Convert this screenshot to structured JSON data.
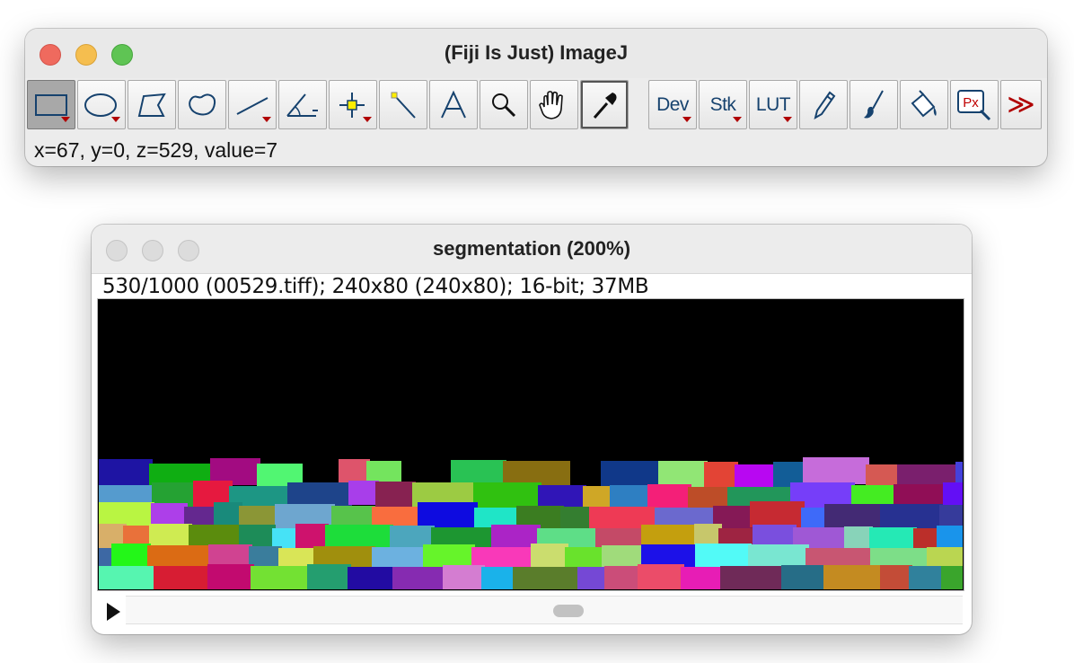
{
  "main_window": {
    "title": "(Fiji Is Just) ImageJ",
    "status": "x=67, y=0, z=529, value=7",
    "tools": [
      {
        "name": "rectangle-tool",
        "icon": "rectangle-icon",
        "selected": true,
        "has_menu": true
      },
      {
        "name": "oval-tool",
        "icon": "oval-icon",
        "has_menu": true
      },
      {
        "name": "polygon-tool",
        "icon": "polygon-icon"
      },
      {
        "name": "freehand-tool",
        "icon": "freehand-icon"
      },
      {
        "name": "line-tool",
        "icon": "line-icon",
        "has_menu": true
      },
      {
        "name": "angle-tool",
        "icon": "angle-icon"
      },
      {
        "name": "point-tool",
        "icon": "point-icon",
        "has_menu": true
      },
      {
        "name": "wand-tool",
        "icon": "wand-icon"
      },
      {
        "name": "text-tool",
        "icon": "text-icon",
        "label": "A"
      },
      {
        "name": "zoom-tool",
        "icon": "magnifier-icon"
      },
      {
        "name": "hand-tool",
        "icon": "hand-icon"
      },
      {
        "name": "dropper-tool",
        "icon": "dropper-icon"
      },
      {
        "name": "dev-menu",
        "label": "Dev",
        "has_menu": true
      },
      {
        "name": "stk-menu",
        "label": "Stk",
        "has_menu": true
      },
      {
        "name": "lut-menu",
        "label": "LUT",
        "has_menu": true
      },
      {
        "name": "pencil-tool",
        "icon": "pencil-icon"
      },
      {
        "name": "brush-tool",
        "icon": "brush-icon"
      },
      {
        "name": "flood-fill-tool",
        "icon": "paint-bucket-icon"
      },
      {
        "name": "pixel-inspector-tool",
        "icon": "pixel-inspector-icon",
        "label": "Px"
      },
      {
        "name": "more-tools",
        "icon": "double-chevron-icon",
        "label": "≫"
      }
    ]
  },
  "image_window": {
    "title": "segmentation (200%)",
    "info": "530/1000 (00529.tiff); 240x80   (240x80); 16-bit; 37MB",
    "slice": 530,
    "slice_count": 1000
  },
  "colors": {
    "icon_blue": "#16426e",
    "menu_red": "#b00000",
    "canvas_bg": "#000000"
  }
}
